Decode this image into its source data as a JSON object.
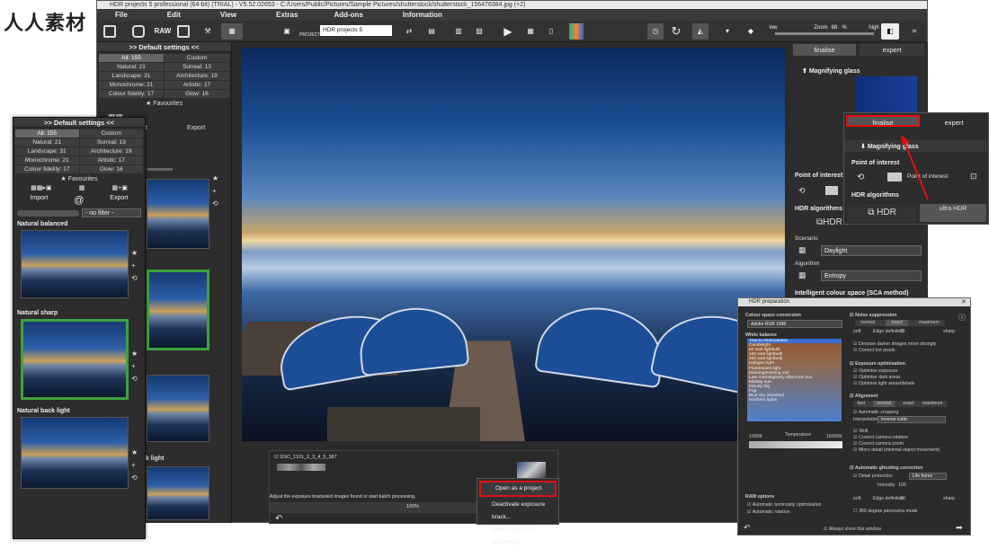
{
  "watermark_logo": "人人素材",
  "window": {
    "title": "HDR projects 5 professional (64-bit) (TRIAL) - V5.52.02653 - C:/Users/Public/Pictures/Sample Pictures/shutterstock/shutterstock_156476384.jpg (+2)"
  },
  "menu": [
    "File",
    "Edit",
    "View",
    "Extras",
    "Add-ons",
    "Information"
  ],
  "toolbar": {
    "raw_label": "RAW",
    "projects_label": "PROJECTS",
    "project_select": "HDR projects 5",
    "zoom_label": "Zoom",
    "zoom_value": "88",
    "zoom_unit": "%",
    "low_label": "low",
    "high_label": "high"
  },
  "left_panel": {
    "header": ">> Default settings <<",
    "filters": [
      {
        "label": "All: 155",
        "selected": true
      },
      {
        "label": "Custom",
        "selected": false
      },
      {
        "label": "Natural: 21",
        "selected": false
      },
      {
        "label": "Surreal: 13",
        "selected": false
      },
      {
        "label": "Landscape: 31",
        "selected": false
      },
      {
        "label": "Architecture: 19",
        "selected": false
      },
      {
        "label": "Monochrome: 21",
        "selected": false
      },
      {
        "label": "Artistic: 17",
        "selected": false
      },
      {
        "label": "Colour fidelity: 17",
        "selected": false
      },
      {
        "label": "Glow: 16",
        "selected": false
      }
    ],
    "favourites": "Favourites",
    "import": "Import",
    "export": "Export",
    "filter_select": "- no filter -",
    "presets": [
      {
        "name": "Natural balanced",
        "selected": false
      },
      {
        "name": "Natural sharp",
        "selected": true
      },
      {
        "name": "Natural back light",
        "selected": false
      }
    ],
    "partial_label": "ck light"
  },
  "right_panel": {
    "tabs": [
      "finalise",
      "expert"
    ],
    "magnifying_glass": "Magnifying glass",
    "point_of_interest": "Point of interest",
    "point_of_interest_btn": "Point of interest",
    "hdr_algorithms": "HDR algorithms",
    "hdr_label": "HDR",
    "ultra_hdr_label": "ultra HDR",
    "scenario_label": "Scenario",
    "scenario_value": "Daylight",
    "algorithm_label": "Algorithm",
    "algorithm_value": "Entropy",
    "intelligent_colour": "Intelligent colour space (SCA method)"
  },
  "filmstrip": {
    "filename": "DSC_1101_2_3_4_5_387",
    "hint": "Adjust the exposure bracketed images found or start batch processing.",
    "progress": "100%"
  },
  "context_menu": {
    "items": [
      "Open as a project",
      "Deactivate exposure brack...",
      "Delete exposure bracketing"
    ]
  },
  "hdr_prep": {
    "title": "HDR preparation",
    "colour_space": "Colour space conversion",
    "colour_space_value": "Adobe RGB 1998",
    "white_balance": "White balance",
    "wb_items": [
      "True to shot/camera",
      "Candlelight",
      "60 watt lightbulb",
      "100 watt lightbulb",
      "200 watt lightbulb",
      "Halogen light",
      "Fluorescent light",
      "Morning/evening sun",
      "Late morning/early afternoon sun",
      "Midday sun",
      "Cloudy sky",
      "Fog",
      "Blue sky (shadow)",
      "Northern lights"
    ],
    "temp_label": "Temperature",
    "temp_min": "1000K",
    "temp_max": "16000K",
    "raw_options": "RAW options",
    "raw_opt1": "Automatic luminosity optimisation",
    "raw_opt2": "Automatic rotation",
    "noise": "Noise suppression",
    "noise_levels": [
      "normal",
      "exact",
      "maximum"
    ],
    "edge_definition_label": "Edge definition",
    "edge_value": "25",
    "soft_label": "soft",
    "sharp_label": "sharp",
    "noise_opt1": "Denoise darker images more strongly",
    "noise_opt2": "Correct hot pixels",
    "exposure_opt": "Exposure optimisation",
    "exp1": "Optimise exposure",
    "exp2": "Optimise dark areas",
    "exp3": "Optimise light areas/details",
    "alignment": "Alignment",
    "align_levels": [
      "fast",
      "normal",
      "exact",
      "maximum"
    ],
    "align1": "Automatic cropping",
    "interpolation_label": "Interpolation:",
    "interpolation_value": "Inverse cubic",
    "shift": "Shift",
    "align2": "Correct camera rotation",
    "align3": "Correct camera zoom",
    "align4": "Micro detail (minimal object movement)",
    "ghost": "Automatic ghosting correction",
    "ghost_detail": "Detail protection",
    "ghost_value": "Life forms",
    "intensity_label": "Intensity",
    "intensity_value": "100",
    "ghost_edge_value": "10",
    "panorama": "360 degree panorama mode",
    "always_show": "Always show this window"
  }
}
